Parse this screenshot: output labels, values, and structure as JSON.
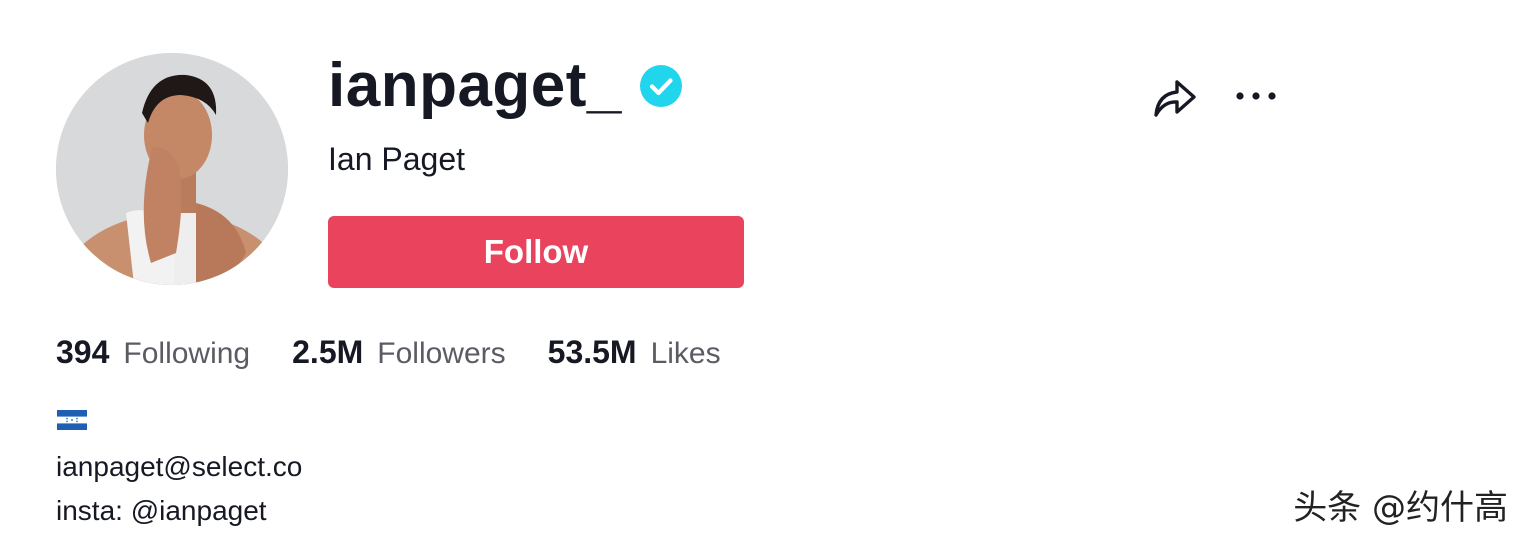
{
  "profile": {
    "username": "ianpaget_",
    "display_name": "Ian Paget",
    "verified": true,
    "follow_label": "Follow"
  },
  "stats": [
    {
      "value": "394",
      "label": "Following"
    },
    {
      "value": "2.5M",
      "label": "Followers"
    },
    {
      "value": "53.5M",
      "label": "Likes"
    }
  ],
  "bio": {
    "flag": "honduras-flag",
    "email": "ianpaget@select.co",
    "insta": "insta: @ianpaget"
  },
  "icons": {
    "share": "share-icon",
    "more": "more-icon",
    "verified": "verified-badge-icon"
  },
  "colors": {
    "follow_bg": "#ea435d",
    "verified_badge": "#20d5ec",
    "text_primary": "#161823",
    "text_secondary": "#5b5c63"
  },
  "watermark": "头条 @约什高"
}
